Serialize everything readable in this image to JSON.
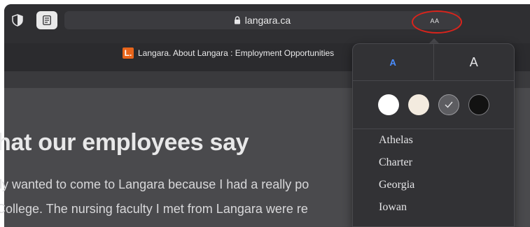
{
  "toolbar": {
    "url": "langara.ca",
    "text_size_button_label": "AA"
  },
  "tab": {
    "favicon_letter": "L.",
    "title": "Langara. About Langara : Employment Opportunities"
  },
  "page": {
    "heading": "hat our employees say",
    "paragraph_line1": "lly wanted to come to Langara because I had a really po",
    "paragraph_line2": "College. The nursing faculty I met from Langara were re"
  },
  "reader_popover": {
    "smaller_text_label": "A",
    "larger_text_label": "A",
    "themes": [
      {
        "name": "white",
        "color": "#ffffff",
        "selected": false
      },
      {
        "name": "sepia",
        "color": "#f3ebdf",
        "selected": false
      },
      {
        "name": "gray",
        "color": "#5d5d61",
        "selected": true
      },
      {
        "name": "black",
        "color": "#121212",
        "selected": false
      }
    ],
    "fonts": [
      "Athelas",
      "Charter",
      "Georgia",
      "Iowan"
    ]
  }
}
